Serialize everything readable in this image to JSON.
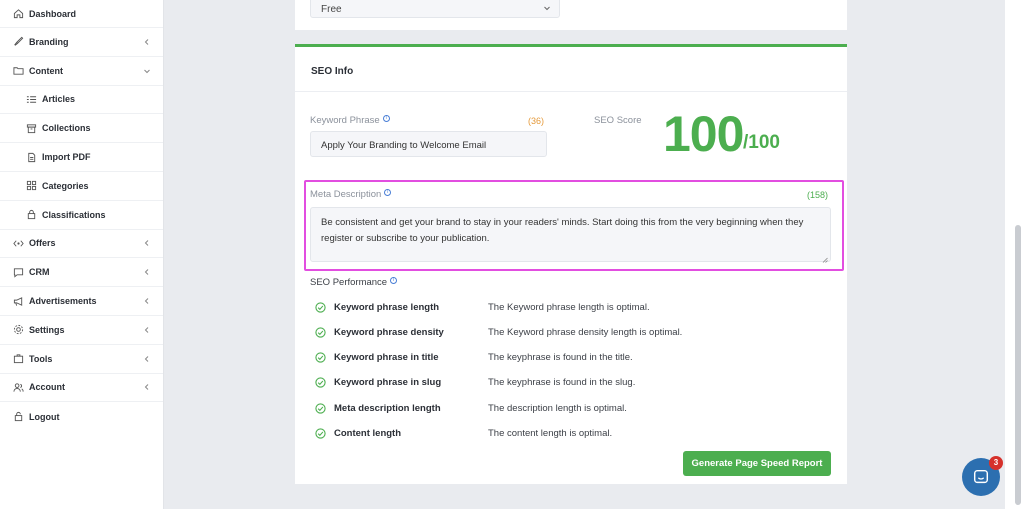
{
  "sidebar": {
    "items": [
      {
        "label": "Dashboard",
        "icon": "home-icon",
        "has_chevron": false
      },
      {
        "label": "Branding",
        "icon": "brush-icon",
        "has_chevron": true
      },
      {
        "label": "Content",
        "icon": "folder-icon",
        "has_chevron": true
      },
      {
        "label": "Articles",
        "icon": "list-icon",
        "sub": true
      },
      {
        "label": "Collections",
        "icon": "archive-icon",
        "sub": true
      },
      {
        "label": "Import PDF",
        "icon": "file-icon",
        "sub": true
      },
      {
        "label": "Categories",
        "icon": "grid-icon",
        "sub": true
      },
      {
        "label": "Classifications",
        "icon": "lock-icon",
        "sub": true
      },
      {
        "label": "Offers",
        "icon": "tag-icon",
        "has_chevron": true
      },
      {
        "label": "CRM",
        "icon": "chat-icon",
        "has_chevron": true
      },
      {
        "label": "Advertisements",
        "icon": "megaphone-icon",
        "has_chevron": true
      },
      {
        "label": "Settings",
        "icon": "gear-icon",
        "has_chevron": true
      },
      {
        "label": "Tools",
        "icon": "briefcase-icon",
        "has_chevron": true
      },
      {
        "label": "Account",
        "icon": "users-icon",
        "has_chevron": true
      },
      {
        "label": "Logout",
        "icon": "logout-icon",
        "has_chevron": false
      }
    ]
  },
  "top_select": {
    "value": "Free"
  },
  "seo": {
    "title": "SEO Info",
    "keyword_label": "Keyword Phrase",
    "keyword_count": "(36)",
    "keyword_value": "Apply Your Branding to Welcome Email",
    "score_label": "SEO Score",
    "score_value": "100",
    "score_max": "/100",
    "meta_label": "Meta Description",
    "meta_count": "(158)",
    "meta_value": "Be consistent and get your brand to stay in your readers' minds. Start doing this from the very beginning when they register or subscribe to your publication.",
    "performance_label": "SEO Performance",
    "performance": [
      {
        "name": "Keyword phrase length",
        "desc": "The Keyword phrase length is optimal."
      },
      {
        "name": "Keyword phrase density",
        "desc": "The Keyword phrase density length is optimal."
      },
      {
        "name": "Keyword phrase in title",
        "desc": "The keyphrase is found in the title."
      },
      {
        "name": "Keyword phrase in slug",
        "desc": "The keyphrase is found in the slug."
      },
      {
        "name": "Meta description length",
        "desc": "The description length is optimal."
      },
      {
        "name": "Content length",
        "desc": "The content length is optimal."
      }
    ],
    "button_label": "Generate Page Speed Report"
  },
  "chat": {
    "badge": "3"
  },
  "colors": {
    "accent": "#4cae4f",
    "count_orange": "#e59a3b",
    "highlight": "#e24ee0",
    "chat": "#2c6fb0"
  }
}
